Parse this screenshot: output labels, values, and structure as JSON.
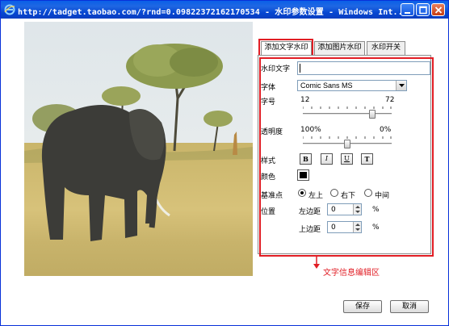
{
  "window": {
    "title": "http://tadget.taobao.com/?rnd=0.09822372162170534 - 水印参数设置 - Windows Int..."
  },
  "tabs": [
    {
      "label": "添加文字水印",
      "active": true
    },
    {
      "label": "添加图片水印",
      "active": false
    },
    {
      "label": "水印开关",
      "active": false
    }
  ],
  "form": {
    "watermark_text_label": "水印文字",
    "watermark_text_value": "",
    "font_label": "字体",
    "font_value": "Comic Sans MS",
    "size_label": "字号",
    "size_min": "12",
    "size_max": "72",
    "size_level": 0.8,
    "opacity_label": "透明度",
    "opacity_min": "100%",
    "opacity_max": "0%",
    "opacity_level": 0.5,
    "style_label": "样式",
    "style_buttons": [
      "B",
      "I",
      "U",
      "T"
    ],
    "color_label": "颜色",
    "color_value": "#000000",
    "anchor_label": "基准点",
    "anchor_options": [
      {
        "label": "左上",
        "checked": true
      },
      {
        "label": "右下",
        "checked": false
      },
      {
        "label": "中间",
        "checked": false
      }
    ],
    "position_label": "位置",
    "left_margin_label": "左边距",
    "left_margin_value": "0",
    "top_margin_label": "上边距",
    "top_margin_value": "0",
    "unit": "%"
  },
  "annotation": {
    "text": "文字信息编辑区",
    "color": "#e11d24"
  },
  "buttons": {
    "save": "保存",
    "cancel": "取消"
  },
  "colors": {
    "titlebar": "#0a5fe8",
    "accent_red": "#e11d24"
  }
}
